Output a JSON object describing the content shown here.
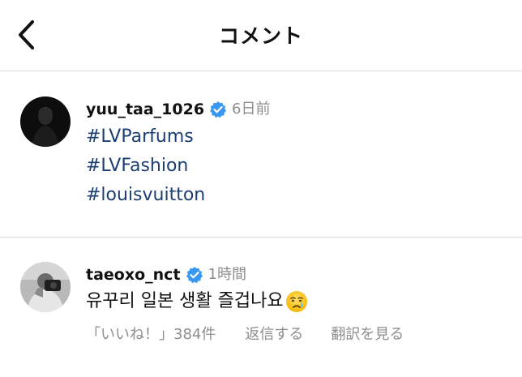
{
  "header": {
    "back_icon": "chevron-left-icon",
    "title": "コメント"
  },
  "post": {
    "username": "yuu_taa_1026",
    "verified_icon": "verified-badge-icon",
    "timestamp": "6日前",
    "hashtags": [
      "#LVParfums",
      "#LVFashion",
      "#louisvuitton"
    ]
  },
  "comment": {
    "username": "taeoxo_nct",
    "verified_icon": "verified-badge-icon",
    "timestamp": "1時間",
    "text": "유꾸리 일본 생활 즐겁나요",
    "emoji_icon": "crying-face-emoji-icon",
    "likes_label": "「いいね！」384件",
    "reply_label": "返信する",
    "translate_label": "翻訳を見る"
  },
  "colors": {
    "hashtag": "#1b3f73",
    "verified": "#3897f0",
    "muted": "#8e8e8e",
    "divider": "#dbdbdb"
  }
}
